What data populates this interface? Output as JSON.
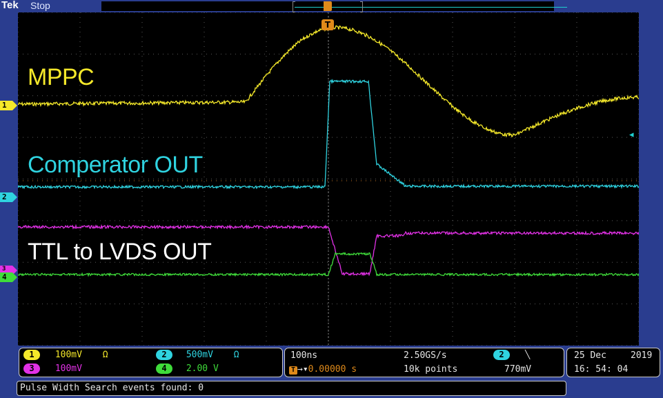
{
  "topbar": {
    "brand": "Tek",
    "run_state": "Stop"
  },
  "trigger": {
    "position_marker": "T",
    "level_marker_color": "#1fd0d0"
  },
  "labels": {
    "mppc": "MPPC",
    "comparator": "Comperator OUT",
    "ttl_lvds": "TTL to LVDS OUT"
  },
  "channels": [
    {
      "num": "1",
      "color": "#f4e82a",
      "scale": "100mV",
      "coupling": "Ω"
    },
    {
      "num": "2",
      "color": "#2fd3e0",
      "scale": "500mV",
      "coupling": "Ω"
    },
    {
      "num": "3",
      "color": "#e231e6",
      "scale": "100mV",
      "coupling": ""
    },
    {
      "num": "4",
      "color": "#3fdc3a",
      "scale": "2.00 V",
      "coupling": ""
    }
  ],
  "timebase": {
    "scale": "100ns",
    "sample_rate": "2.50GS/s",
    "trigger_delay": "0.00000 s",
    "record_length": "10k points",
    "trigger_source": "2",
    "trigger_slope": "╲",
    "trigger_level": "770mV"
  },
  "datetime": {
    "date": "25 Dec",
    "year": "2019",
    "time": "16: 54: 04"
  },
  "status": {
    "message": "Pulse Width Search events found: 0"
  },
  "colors": {
    "frame": "#2a3d8f",
    "grid": "#5a5a5a",
    "trigger_line": "#c87a2a"
  }
}
